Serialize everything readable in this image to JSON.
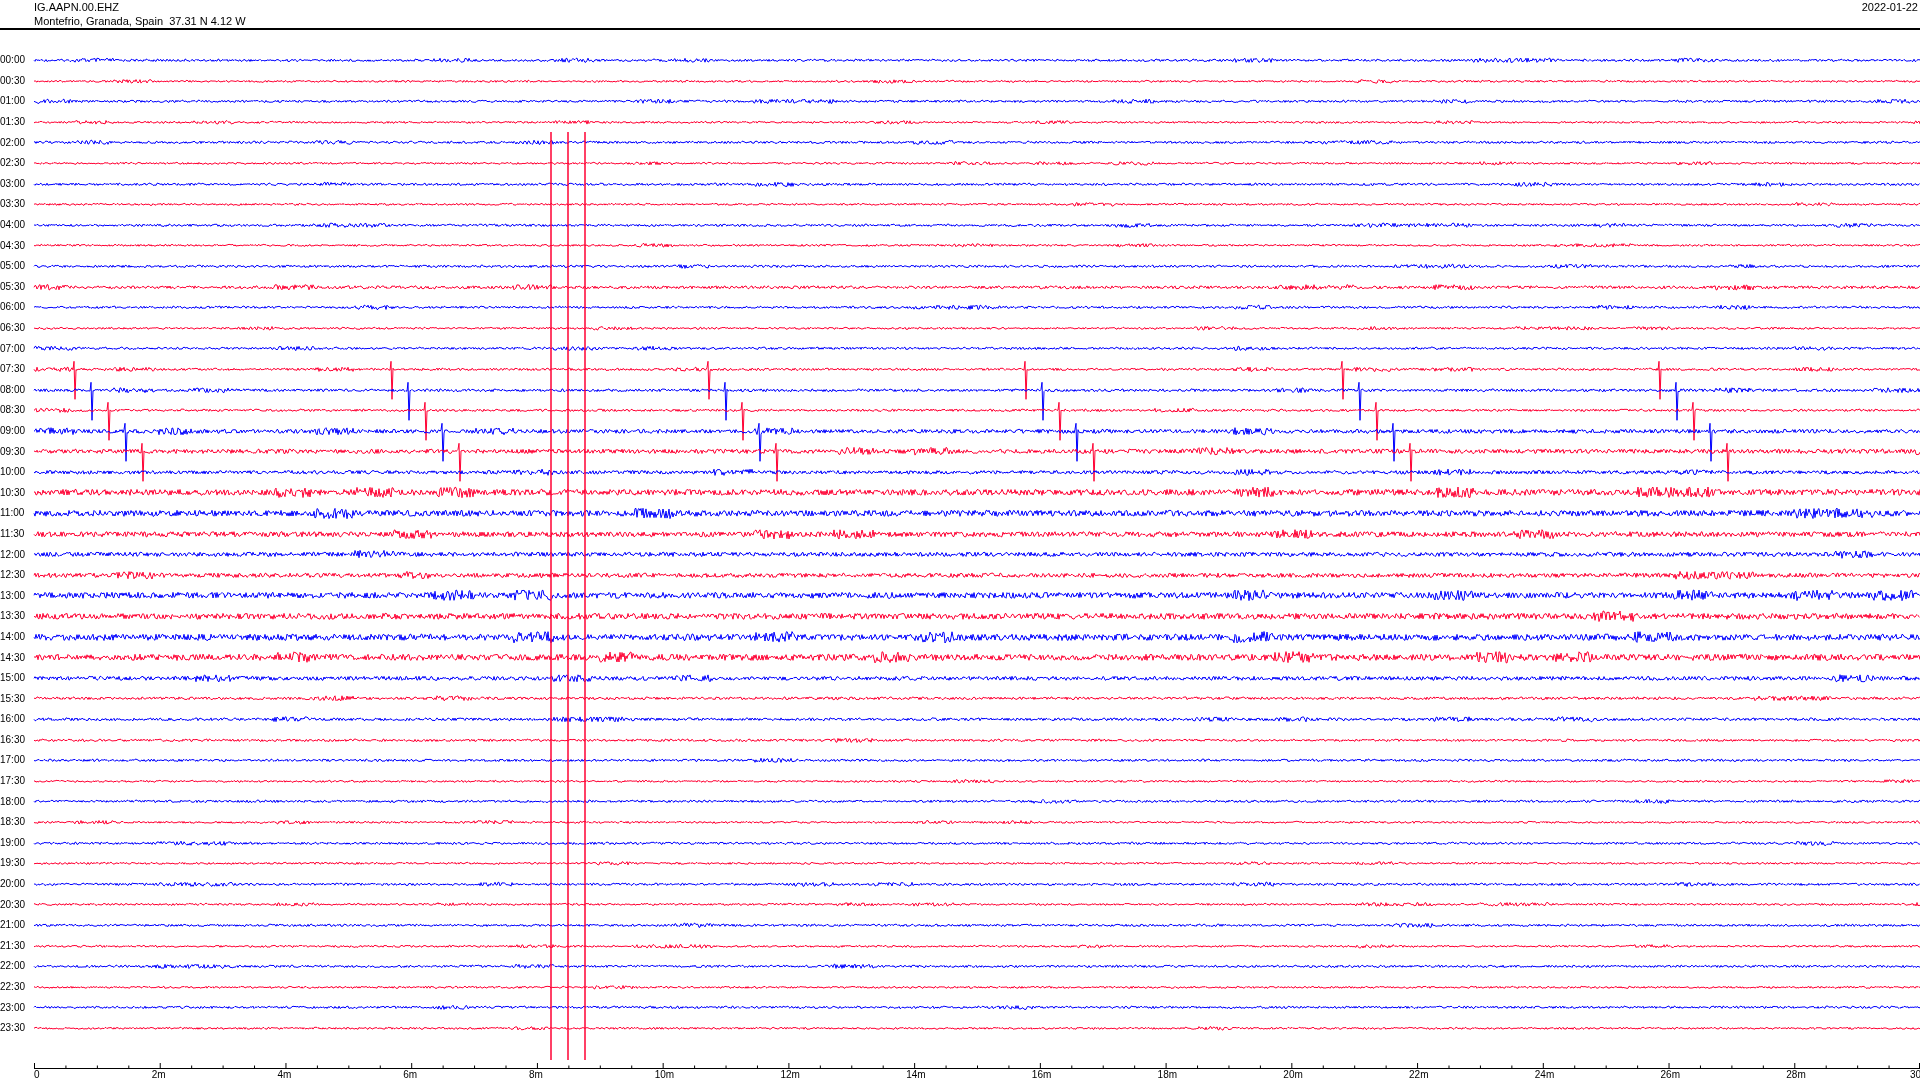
{
  "header": {
    "station": "IG.AAPN.00.EHZ",
    "location": "Montefrio, Granada, Spain  37.31 N 4.12 W",
    "date": "2022-01-22"
  },
  "rows": [
    {
      "time": "00:00",
      "color": "#0000ff"
    },
    {
      "time": "00:30",
      "color": "#ff0033"
    },
    {
      "time": "01:00",
      "color": "#0000ff"
    },
    {
      "time": "01:30",
      "color": "#ff0033"
    },
    {
      "time": "02:00",
      "color": "#0000ff"
    },
    {
      "time": "02:30",
      "color": "#ff0033"
    },
    {
      "time": "03:00",
      "color": "#0000ff"
    },
    {
      "time": "03:30",
      "color": "#ff0033"
    },
    {
      "time": "04:00",
      "color": "#0000ff"
    },
    {
      "time": "04:30",
      "color": "#ff0033"
    },
    {
      "time": "05:00",
      "color": "#0000ff"
    },
    {
      "time": "05:30",
      "color": "#ff0033"
    },
    {
      "time": "06:00",
      "color": "#0000ff"
    },
    {
      "time": "06:30",
      "color": "#ff0033"
    },
    {
      "time": "07:00",
      "color": "#0000ff"
    },
    {
      "time": "07:30",
      "color": "#ff0033"
    },
    {
      "time": "08:00",
      "color": "#0000ff"
    },
    {
      "time": "08:30",
      "color": "#ff0033"
    },
    {
      "time": "09:00",
      "color": "#0000ff"
    },
    {
      "time": "09:30",
      "color": "#ff0033"
    },
    {
      "time": "10:00",
      "color": "#0000ff"
    },
    {
      "time": "10:30",
      "color": "#ff0033"
    },
    {
      "time": "11:00",
      "color": "#0000ff"
    },
    {
      "time": "11:30",
      "color": "#ff0033"
    },
    {
      "time": "12:00",
      "color": "#0000ff"
    },
    {
      "time": "12:30",
      "color": "#ff0033"
    },
    {
      "time": "13:00",
      "color": "#0000ff"
    },
    {
      "time": "13:30",
      "color": "#ff0033"
    },
    {
      "time": "14:00",
      "color": "#0000ff"
    },
    {
      "time": "14:30",
      "color": "#ff0033"
    },
    {
      "time": "15:00",
      "color": "#0000ff"
    },
    {
      "time": "15:30",
      "color": "#ff0033"
    },
    {
      "time": "16:00",
      "color": "#0000ff"
    },
    {
      "time": "16:30",
      "color": "#ff0033"
    },
    {
      "time": "17:00",
      "color": "#0000ff"
    },
    {
      "time": "17:30",
      "color": "#ff0033"
    },
    {
      "time": "18:00",
      "color": "#0000ff"
    },
    {
      "time": "18:30",
      "color": "#ff0033"
    },
    {
      "time": "19:00",
      "color": "#0000ff"
    },
    {
      "time": "19:30",
      "color": "#ff0033"
    },
    {
      "time": "20:00",
      "color": "#0000ff"
    },
    {
      "time": "20:30",
      "color": "#ff0033"
    },
    {
      "time": "21:00",
      "color": "#0000ff"
    },
    {
      "time": "21:30",
      "color": "#ff0033"
    },
    {
      "time": "22:00",
      "color": "#0000ff"
    },
    {
      "time": "22:30",
      "color": "#ff0033"
    },
    {
      "time": "23:00",
      "color": "#0000ff"
    },
    {
      "time": "23:30",
      "color": "#ff0033"
    }
  ],
  "axis_labels": [
    "0",
    "2m",
    "4m",
    "6m",
    "8m",
    "10m",
    "12m",
    "14m",
    "16m",
    "18m",
    "20m",
    "22m",
    "24m",
    "26m",
    "28m",
    "30"
  ]
}
